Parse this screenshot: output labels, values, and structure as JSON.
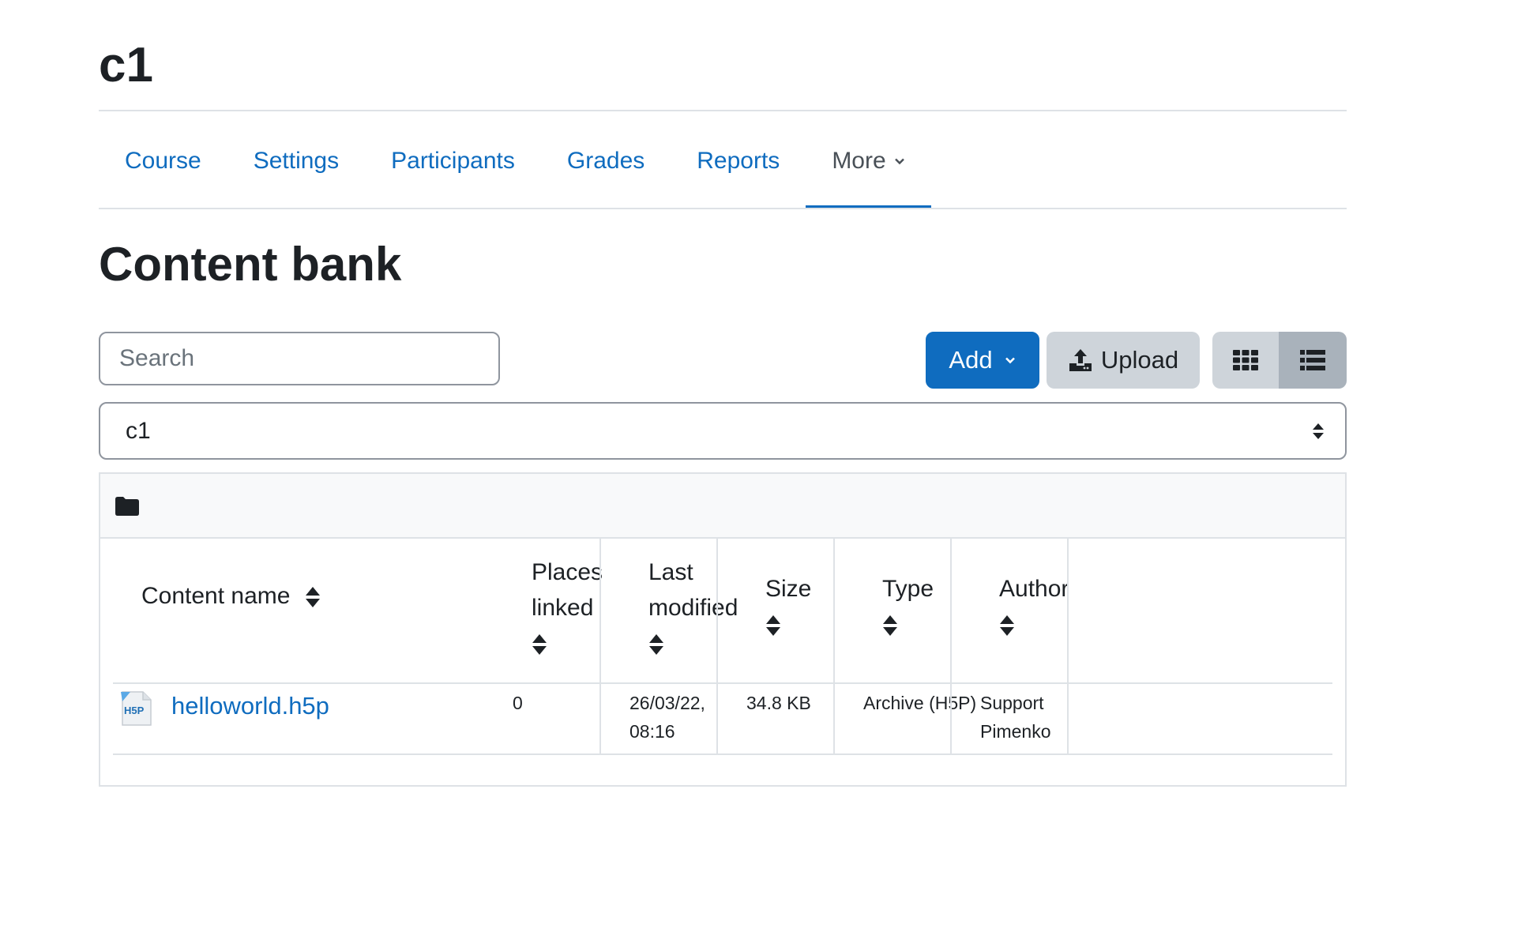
{
  "course": {
    "title": "c1"
  },
  "nav": {
    "tabs": [
      {
        "label": "Course"
      },
      {
        "label": "Settings"
      },
      {
        "label": "Participants"
      },
      {
        "label": "Grades"
      },
      {
        "label": "Reports"
      },
      {
        "label": "More",
        "active": true
      }
    ]
  },
  "page": {
    "heading": "Content bank"
  },
  "toolbar": {
    "search_placeholder": "Search",
    "add_label": "Add",
    "upload_label": "Upload"
  },
  "context_select": {
    "value": "c1"
  },
  "table": {
    "headers": {
      "name": "Content name",
      "places_line1": "Places",
      "places_line2": "linked",
      "modified_line1": "Last",
      "modified_line2": "modified",
      "size": "Size",
      "type": "Type",
      "author": "Author"
    },
    "rows": [
      {
        "name": "helloworld.h5p",
        "places": "0",
        "modified_date": "26/03/22,",
        "modified_time": "08:16",
        "size": "34.8 KB",
        "type": "Archive (H5P)",
        "author_first": "Support",
        "author_last": "Pimenko",
        "icon": "h5p-file-icon"
      }
    ]
  },
  "colors": {
    "primary": "#0f6cbf",
    "secondary": "#ced4da",
    "border": "#dee2e6",
    "text": "#1d2125"
  }
}
